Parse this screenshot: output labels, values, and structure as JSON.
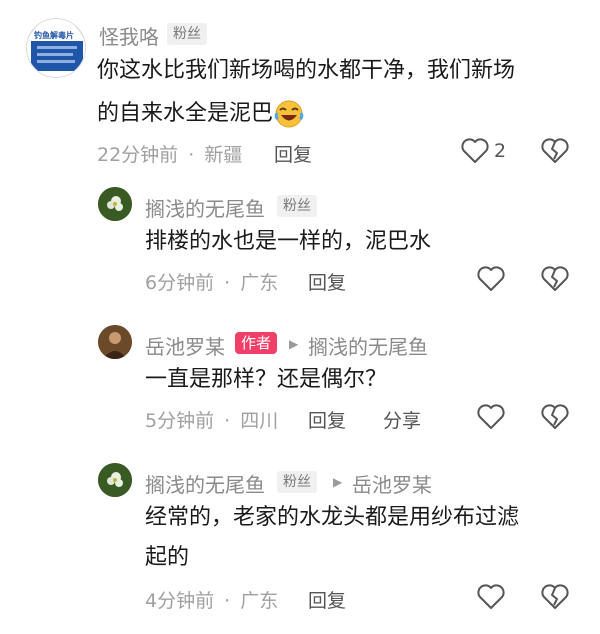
{
  "comments": [
    {
      "username": "怪我咯",
      "badge": "粉丝",
      "text_line1": "你这水比我们新场喝的水都干净，我们新场",
      "text_line2": "的自来水全是泥巴",
      "emoji": "laughing-emoji",
      "time": "22分钟前",
      "location": "新疆",
      "reply_label": "回复",
      "like_count": "2"
    },
    {
      "username": "搁浅的无尾鱼",
      "badge": "粉丝",
      "text": "排楼的水也是一样的，泥巴水",
      "time": "6分钟前",
      "location": "广东",
      "reply_label": "回复"
    },
    {
      "username": "岳池罗某",
      "author_badge": "作者",
      "reply_to": "搁浅的无尾鱼",
      "text": "一直是那样？还是偶尔？",
      "time": "5分钟前",
      "location": "四川",
      "reply_label": "回复",
      "share_label": "分享"
    },
    {
      "username": "搁浅的无尾鱼",
      "badge": "粉丝",
      "reply_to": "岳池罗某",
      "text_line1": "经常的，老家的水龙头都是用纱布过滤",
      "text_line2": "起的",
      "time": "4分钟前",
      "location": "广东",
      "reply_label": "回复"
    }
  ],
  "separator": "·",
  "colors": {
    "author_badge": "#f0406a",
    "text": "#1a1a1a",
    "meta": "#a0a0a0",
    "icon": "#555555"
  }
}
